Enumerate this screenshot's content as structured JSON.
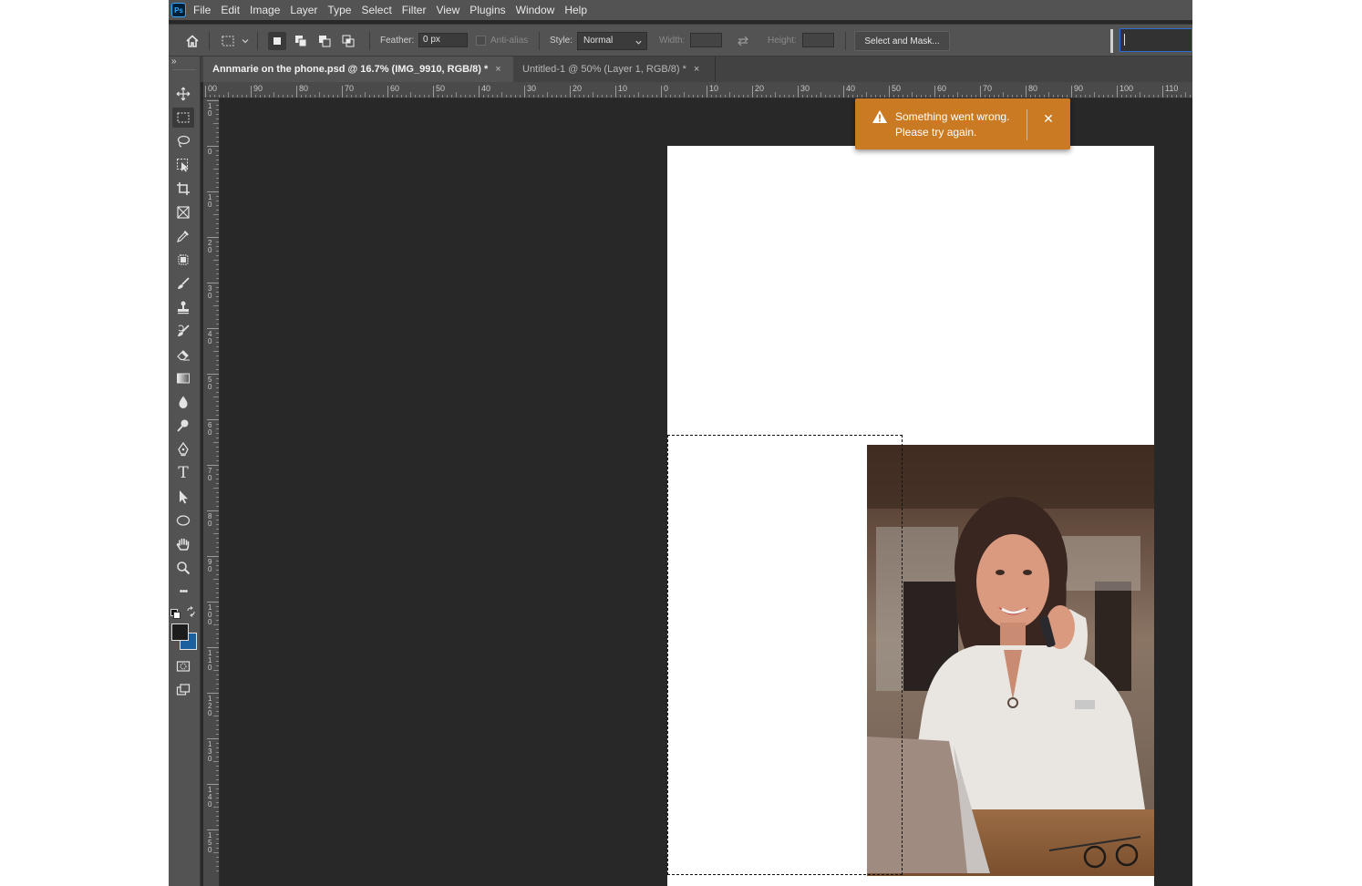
{
  "app": {
    "logo_text": "Ps"
  },
  "menu": [
    "File",
    "Edit",
    "Image",
    "Layer",
    "Type",
    "Select",
    "Filter",
    "View",
    "Plugins",
    "Window",
    "Help"
  ],
  "options_bar": {
    "feather_label": "Feather:",
    "feather_value": "0 px",
    "anti_alias_label": "Anti-alias",
    "style_label": "Style:",
    "style_value": "Normal",
    "width_label": "Width:",
    "height_label": "Height:",
    "select_mask_label": "Select and Mask..."
  },
  "tabs": [
    {
      "label": "Annmarie on the phone.psd @ 16.7% (IMG_9910, RGB/8) *",
      "active": true
    },
    {
      "label": "Untitled-1 @ 50% (Layer 1, RGB/8) *",
      "active": false
    }
  ],
  "tab_close_glyph": "×",
  "rulers": {
    "horizontal": [
      "00",
      "90",
      "80",
      "70",
      "60",
      "50",
      "40",
      "30",
      "20",
      "10",
      "0",
      "10",
      "20",
      "30",
      "40",
      "50",
      "60",
      "70",
      "80",
      "90",
      "100",
      "110"
    ],
    "vertical": [
      "10",
      "0",
      "10",
      "20",
      "30",
      "40",
      "50",
      "60",
      "70",
      "80",
      "90",
      "100",
      "110",
      "120",
      "130",
      "140",
      "150"
    ]
  },
  "toast": {
    "message_line1": "Something went wrong.",
    "message_line2": "Please try again.",
    "close_glyph": "✕",
    "color": "#c97a23"
  },
  "toolbar": {
    "tools": [
      "move-icon",
      "marquee-icon",
      "lasso-icon",
      "object-select-icon",
      "crop-icon",
      "frame-icon",
      "eyedropper-icon",
      "healing-icon",
      "brush-icon",
      "stamp-icon",
      "history-brush-icon",
      "eraser-icon",
      "gradient-icon",
      "blur-icon",
      "dodge-icon",
      "pen-icon",
      "type-icon",
      "path-select-icon",
      "ellipse-icon",
      "hand-icon",
      "zoom-icon",
      "more-icon"
    ],
    "type_glyph": "T",
    "more_glyph": "•••",
    "foreground_color": "#1c1c1c",
    "background_color": "#1a5f9e"
  }
}
